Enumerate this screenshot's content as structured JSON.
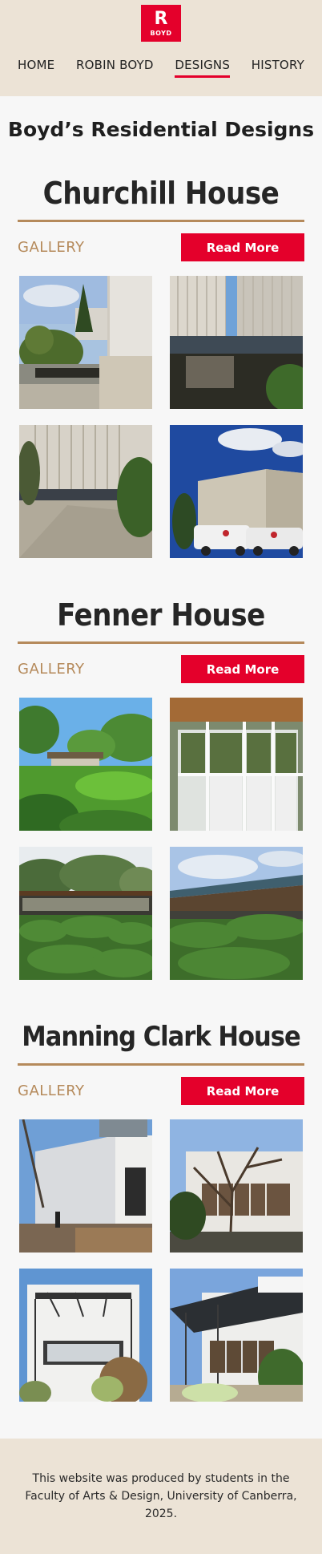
{
  "brand": {
    "letter": "R",
    "word": "BOYD"
  },
  "nav": [
    "HOME",
    "ROBIN BOYD",
    "DESIGNS",
    "HISTORY"
  ],
  "nav_active": "DESIGNS",
  "page_title": "Boyd’s Residential Designs",
  "houses": [
    {
      "title": "Churchill House",
      "gallery_label": "GALLERY",
      "read_more": "Read More",
      "photos": [
        "garden courtyard with pond",
        "pond reflecting facade",
        "paved courtyard with facade",
        "building with parked vans"
      ]
    },
    {
      "title": "Fenner House",
      "gallery_label": "GALLERY",
      "read_more": "Read More",
      "photos": [
        "house in green garden",
        "window wall interior view",
        "house behind hedge",
        "house roofline and hedge"
      ]
    },
    {
      "title": "Manning Clark House",
      "gallery_label": "GALLERY",
      "read_more": "Read More",
      "photos": [
        "white brick house with deck",
        "house with bare tree",
        "two-storey facade with pergola",
        "facade with balcony pergola"
      ]
    }
  ],
  "footer": "This website was produced by students in the Faculty of Arts & Design, University of Canberra, 2025.",
  "colors": {
    "accent": "#e4002b",
    "tan": "#b58a5b",
    "header_bg": "#ece3d6"
  }
}
